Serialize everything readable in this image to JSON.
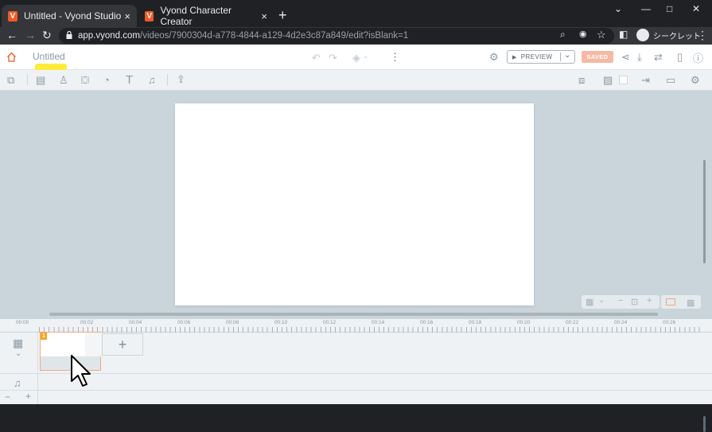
{
  "browser": {
    "tabs": [
      {
        "label": "Untitled - Vyond Studio",
        "favicon": "V",
        "close": "×"
      },
      {
        "label": "Vyond Character Creator",
        "favicon": "V",
        "close": "×"
      }
    ],
    "new_tab": "+",
    "window_controls": {
      "minimize": "—",
      "restore": "□",
      "close": "✕",
      "menu": "⌄"
    },
    "url_host": "app.vyond.com",
    "url_path": "/videos/7900304d-a778-4844-a129-4d2e3c87a849/edit?isBlank=1",
    "incognito_label": "シークレット"
  },
  "app": {
    "title": "Untitled",
    "preview_label": "PREVIEW",
    "saved_label": "SAVED",
    "brand_color": "#f15a24"
  },
  "timeline": {
    "ruler_labels": [
      "00:00",
      "00:02",
      "00:04",
      "00:06",
      "00:08",
      "00:10",
      "00:12",
      "00:14",
      "00:16",
      "00:18",
      "00:20",
      "00:22",
      "00:24",
      "00:26"
    ],
    "scene_number": "1",
    "add_scene": "+",
    "zoom_minus": "−",
    "zoom_plus": "+"
  }
}
